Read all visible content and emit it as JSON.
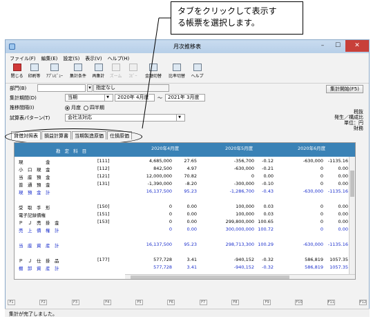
{
  "callout": {
    "line1": "タブをクリックして表示す",
    "line2": "る帳票を選択します。"
  },
  "window": {
    "title": "月次推移表",
    "minimize": "–",
    "maximize": "☐",
    "close": "✕"
  },
  "menu": [
    "ファイル(F)",
    "編集(E)",
    "設定(S)",
    "表示(V)",
    "ヘルプ(H)"
  ],
  "toolbar": [
    {
      "label": "閉じる",
      "icon": "close-icon",
      "enabled": true
    },
    {
      "label": "印刷等",
      "icon": "printer-icon",
      "enabled": true
    },
    {
      "label": "ｱﾌﾟﾚﾋﾞｭｰ",
      "icon": "preview-icon",
      "enabled": true
    },
    {
      "label": "集計条件",
      "icon": "conditions-icon",
      "enabled": true
    },
    {
      "label": "再集計",
      "icon": "recalc-icon",
      "enabled": true
    },
    {
      "label": "ズーム",
      "icon": "zoom-icon",
      "enabled": false
    },
    {
      "label": "ｺﾋﾟｰ",
      "icon": "copy-icon",
      "enabled": false
    },
    {
      "label": "金額切替",
      "icon": "amount-toggle-icon",
      "enabled": true
    },
    {
      "label": "比率切替",
      "icon": "ratio-toggle-icon",
      "enabled": true
    },
    {
      "label": "ヘルプ",
      "icon": "help-icon",
      "enabled": true
    }
  ],
  "form": {
    "dept_label": "部門(B)",
    "dept_value": "指定なし",
    "period_label": "集計期間(D)",
    "period_select": "当期",
    "period_from": "2020年 4月度",
    "tilde": "～",
    "period_to": "2021年 3月度",
    "interval_label": "推移間隔(I)",
    "interval_monthly": "月度",
    "interval_half": "四半期",
    "pattern_label": "試算表パターン(T)",
    "pattern_value": "会社法対応",
    "start_button": "集計開始(F5)"
  },
  "notes": {
    "line1": "税抜",
    "line2": "発生／構成比",
    "line3": "単位：円",
    "line4": "財務"
  },
  "tabs": [
    "貸借対照表",
    "損益計算書",
    "当期製造原価",
    "仕損原価"
  ],
  "grid": {
    "header_account": "勘 定 科 目",
    "months": [
      "2020年4月度",
      "2020年5月度",
      "2020年6月度"
    ],
    "rows": [
      {
        "name": "現　　　　　金",
        "code": "[111]",
        "v1": "4,685,000",
        "r1": "27.65",
        "v2": "-356,700",
        "r2": "-0.12",
        "v3": "-630,000",
        "r3": "-1135.16",
        "blue": false
      },
      {
        "name": "小　口　現　金",
        "code": "[112]",
        "v1": "842,500",
        "r1": "4.97",
        "v2": "-630,000",
        "r2": "-0.21",
        "v3": "0",
        "r3": "0.00",
        "blue": false
      },
      {
        "name": "当　座　預　金",
        "code": "[121]",
        "v1": "12,000,000",
        "r1": "70.82",
        "v2": "0",
        "r2": "0.00",
        "v3": "0",
        "r3": "0.00",
        "blue": false
      },
      {
        "name": "普　通　預　金",
        "code": "[131]",
        "v1": "-1,390,000",
        "r1": "-8.20",
        "v2": "-300,000",
        "r2": "-0.10",
        "v3": "0",
        "r3": "0.00",
        "blue": false
      },
      {
        "name": "現　預　金　計",
        "code": "",
        "v1": "16,137,500",
        "r1": "95.23",
        "v2": "-1,286,700",
        "r2": "-0.43",
        "v3": "-630,000",
        "r3": "-1135.16",
        "blue": true
      },
      {
        "name": "",
        "code": "",
        "v1": "",
        "r1": "",
        "v2": "",
        "r2": "",
        "v3": "",
        "r3": "",
        "blue": false
      },
      {
        "name": "受　取　手　形",
        "code": "[150]",
        "v1": "0",
        "r1": "0.00",
        "v2": "100,000",
        "r2": "0.03",
        "v3": "0",
        "r3": "0.00",
        "blue": false
      },
      {
        "name": "電子記録債権",
        "code": "[151]",
        "v1": "0",
        "r1": "0.00",
        "v2": "100,000",
        "r2": "0.03",
        "v3": "0",
        "r3": "0.00",
        "blue": false
      },
      {
        "name": "Ｐ　Ｊ　売　掛　金",
        "code": "[153]",
        "v1": "0",
        "r1": "0.00",
        "v2": "299,800,000",
        "r2": "100.65",
        "v3": "0",
        "r3": "0.00",
        "blue": false
      },
      {
        "name": "売　上　債　権　計",
        "code": "",
        "v1": "0",
        "r1": "0.00",
        "v2": "300,000,000",
        "r2": "100.72",
        "v3": "0",
        "r3": "0.00",
        "blue": true
      },
      {
        "name": "",
        "code": "",
        "v1": "",
        "r1": "",
        "v2": "",
        "r2": "",
        "v3": "",
        "r3": "",
        "blue": false
      },
      {
        "name": "当　座　資　産　計",
        "code": "",
        "v1": "16,137,500",
        "r1": "95.23",
        "v2": "298,713,300",
        "r2": "100.29",
        "v3": "-630,000",
        "r3": "-1135.16",
        "blue": true
      },
      {
        "name": "",
        "code": "",
        "v1": "",
        "r1": "",
        "v2": "",
        "r2": "",
        "v3": "",
        "r3": "",
        "blue": false
      },
      {
        "name": "Ｐ　Ｊ　仕　掛　品",
        "code": "[177]",
        "v1": "577,728",
        "r1": "3.41",
        "v2": "-940,152",
        "r2": "-0.32",
        "v3": "586,819",
        "r3": "1057.35",
        "blue": false
      },
      {
        "name": "棚　卸　資　産　計",
        "code": "",
        "v1": "577,728",
        "r1": "3.41",
        "v2": "-940,152",
        "r2": "-0.32",
        "v3": "586,819",
        "r3": "1057.35",
        "blue": true
      }
    ]
  },
  "fkeys": [
    "F1",
    "F2",
    "F3",
    "F4",
    "F5",
    "F6",
    "F7",
    "F8",
    "F9",
    "F10",
    "F11",
    "F12"
  ],
  "status": "集計が完了しました。"
}
